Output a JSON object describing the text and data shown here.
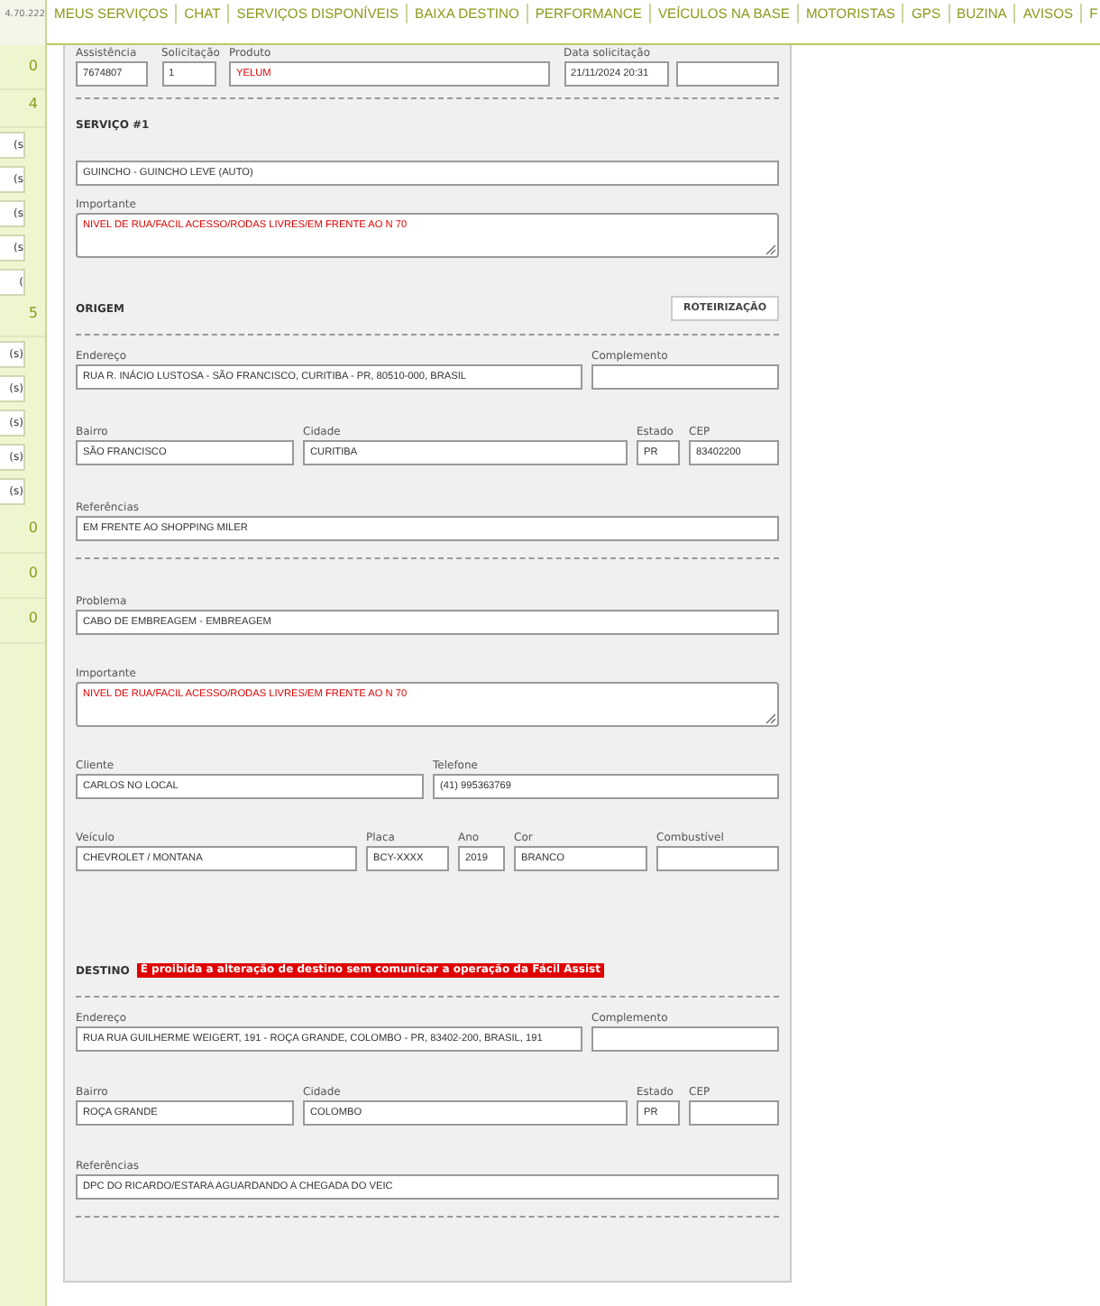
{
  "topbar": {
    "ip": "4.70.222",
    "nav": [
      {
        "label": "MEUS SERVIÇOS"
      },
      {
        "label": "CHAT"
      },
      {
        "label": "SERVIÇOS DISPONÍVEIS"
      },
      {
        "label": "BAIXA DESTINO"
      },
      {
        "label": "PERFORMANCE"
      },
      {
        "label": "VEÍCULOS NA BASE"
      },
      {
        "label": "MOTORISTAS"
      },
      {
        "label": "GPS"
      },
      {
        "label": "BUZINA"
      },
      {
        "label": "AVISOS"
      },
      {
        "label": "F"
      }
    ]
  },
  "sidebar": [
    {
      "kind": "count",
      "text": "0"
    },
    {
      "kind": "count",
      "text": "4"
    },
    {
      "kind": "entry",
      "text": "s)"
    },
    {
      "kind": "entry",
      "text": "s)"
    },
    {
      "kind": "entry",
      "text": "s)"
    },
    {
      "kind": "entry",
      "text": "s)"
    },
    {
      "kind": "entry",
      "text": ")"
    },
    {
      "kind": "count",
      "text": "5"
    },
    {
      "kind": "entry",
      "text": "(s)"
    },
    {
      "kind": "entry",
      "text": "(s)"
    },
    {
      "kind": "entry",
      "text": "(s)"
    },
    {
      "kind": "entry",
      "text": "(s)"
    },
    {
      "kind": "entry",
      "text": "(s)"
    },
    {
      "kind": "count",
      "text": "0"
    },
    {
      "kind": "count",
      "text": "0"
    },
    {
      "kind": "count",
      "text": "0"
    }
  ],
  "form": {
    "sections": [
      {
        "blocks": [
          {
            "kind": "row",
            "fields": [
              {
                "label": "Assistência",
                "value": "7674807",
                "kind": "input",
                "warning": false
              },
              {
                "label": "Solicitação",
                "value": "1",
                "kind": "input",
                "warning": false
              },
              {
                "label": "Produto",
                "value": "YELUM",
                "kind": "input",
                "warning": true
              },
              {
                "label": "Data solicitação",
                "value": "21/11/2024 20:31",
                "kind": "input",
                "warning": false
              },
              {
                "kind": "input"
              }
            ]
          },
          {
            "kind": "divider"
          }
        ]
      },
      {
        "title": "SERVIÇO #1",
        "blocks": [
          {
            "kind": "row",
            "fields": [
              {
                "value": "GUINCHO - GUINCHO LEVE (AUTO)",
                "kind": "input",
                "warning": false
              }
            ]
          },
          {
            "kind": "row",
            "fields": [
              {
                "label": "Importante",
                "value": "NIVEL DE RUA/FACIL ACESSO/RODAS LIVRES/EM FRENTE AO N 70",
                "kind": "textarea",
                "warning": true
              }
            ]
          }
        ]
      },
      {
        "title": "ORIGEM",
        "button": "ROTEIRIZAÇÃO",
        "blocks": [
          {
            "kind": "divider"
          },
          {
            "kind": "row",
            "fields": [
              {
                "label": "Endereço",
                "value": "RUA R. INÁCIO LUSTOSA - SÃO FRANCISCO, CURITIBA - PR, 80510-000, BRASIL",
                "kind": "input",
                "warning": false
              },
              {
                "label": "Complemento",
                "kind": "input"
              }
            ]
          },
          {
            "kind": "row",
            "fields": [
              {
                "label": "Bairro",
                "value": "SÃO FRANCISCO",
                "kind": "input",
                "warning": false
              },
              {
                "label": "Cidade",
                "value": "CURITIBA",
                "kind": "input",
                "warning": false
              },
              {
                "label": "Estado",
                "value": "PR",
                "kind": "input",
                "warning": false
              },
              {
                "label": "CEP",
                "value": "83402200",
                "kind": "input",
                "warning": false
              }
            ]
          },
          {
            "kind": "row",
            "fields": [
              {
                "label": "Referências",
                "value": "EM FRENTE AO SHOPPING MILER",
                "kind": "input",
                "warning": false
              }
            ]
          },
          {
            "kind": "divider"
          }
        ]
      },
      {
        "blocks": [
          {
            "kind": "row",
            "fields": [
              {
                "label": "Problema",
                "value": "CABO DE EMBREAGEM - EMBREAGEM",
                "kind": "input",
                "warning": false
              }
            ]
          },
          {
            "kind": "row",
            "fields": [
              {
                "label": "Importante",
                "value": "NIVEL DE RUA/FACIL ACESSO/RODAS LIVRES/EM FRENTE AO N 70",
                "kind": "textarea",
                "warning": true
              }
            ]
          },
          {
            "kind": "row",
            "fields": [
              {
                "label": "Cliente",
                "value": "CARLOS NO LOCAL",
                "kind": "input",
                "warning": false
              },
              {
                "label": "Telefone",
                "value": "(41) 995363769",
                "kind": "input",
                "warning": false
              }
            ]
          },
          {
            "kind": "row",
            "fields": [
              {
                "label": "Veículo",
                "value": "CHEVROLET / MONTANA",
                "kind": "input",
                "warning": false
              },
              {
                "label": "Placa",
                "value": "BCY-XXXX",
                "kind": "input",
                "warning": false
              },
              {
                "label": "Ano",
                "value": "2019",
                "kind": "input",
                "warning": false
              },
              {
                "label": "Cor",
                "value": "BRANCO",
                "kind": "input",
                "warning": false
              },
              {
                "label": "Combustível",
                "kind": "input"
              }
            ]
          }
        ]
      },
      {
        "title": "DESTINO",
        "alert": "É proibida a alteração de destino sem comunicar a operação da Fácil Assist",
        "blocks": [
          {
            "kind": "divider"
          },
          {
            "kind": "row",
            "fields": [
              {
                "label": "Endereço",
                "value": "RUA RUA GUILHERME WEIGERT, 191 - ROÇA GRANDE, COLOMBO - PR, 83402-200, BRASIL, 191",
                "kind": "input",
                "warning": false
              },
              {
                "label": "Complemento",
                "kind": "input"
              }
            ]
          },
          {
            "kind": "row",
            "fields": [
              {
                "label": "Bairro",
                "value": "ROÇA GRANDE",
                "kind": "input",
                "warning": false
              },
              {
                "label": "Cidade",
                "value": "COLOMBO",
                "kind": "input",
                "warning": false
              },
              {
                "label": "Estado",
                "value": "PR",
                "kind": "input",
                "warning": false
              },
              {
                "label": "CEP",
                "kind": "input"
              }
            ]
          },
          {
            "kind": "row",
            "fields": [
              {
                "label": "Referências",
                "value": "DPC DO RICARDO/ESTARA AGUARDANDO A CHEGADA DO VEIC",
                "kind": "input",
                "warning": false
              }
            ]
          },
          {
            "kind": "divider"
          }
        ]
      }
    ]
  }
}
